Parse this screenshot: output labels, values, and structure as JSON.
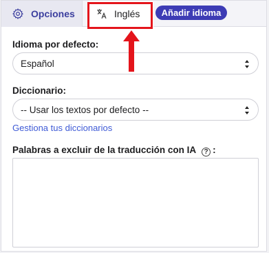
{
  "tabs": {
    "options_label": "Opciones",
    "language_label": "Inglés",
    "add_language_label": "Añadir idioma"
  },
  "form": {
    "default_language_label": "Idioma por defecto:",
    "default_language_value": "Español",
    "dictionary_label": "Diccionario:",
    "dictionary_value": "-- Usar los textos por defecto --",
    "manage_dictionaries_link": "Gestiona tus diccionarios",
    "exclude_words_label": "Palabras a excluir de la traducción con IA",
    "exclude_words_colon": ":",
    "help_glyph": "?"
  },
  "annotation": {
    "highlight_color": "#e4141b"
  },
  "colors": {
    "accent": "#3d3cb5",
    "link": "#3e5ad6"
  },
  "icons": {
    "options_tab": "gear-icon",
    "language_tab": "translate-icon",
    "select_chevrons": "sort-chevrons-icon",
    "help": "help-circle-icon"
  }
}
